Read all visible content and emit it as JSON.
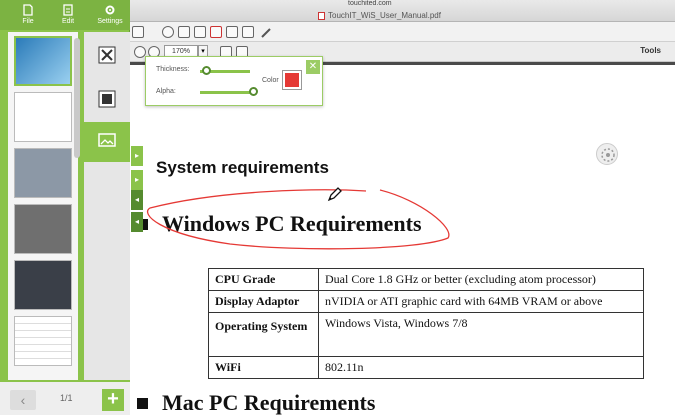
{
  "window": {
    "site": "touchited.com",
    "filename": "TouchIT_WiS_User_Manual.pdf"
  },
  "toolbar": {
    "zoom": "170%",
    "tools_label": "Tools"
  },
  "sidebar": {
    "file_label": "File",
    "edit_label": "Edit",
    "settings_label": "Settings",
    "page_indicator": "1/1",
    "accent_color": "#8bc34a"
  },
  "pen_settings": {
    "thickness_label": "Thickness:",
    "alpha_label": "Alpha:",
    "color_label": "Color",
    "thickness_level": 0.12,
    "alpha_level": 0.95,
    "ink_color": "#e53935"
  },
  "document": {
    "section_heading": "System requirements",
    "win_heading": "Windows PC Requirements",
    "mac_heading": "Mac PC Requirements",
    "table": [
      {
        "key": "CPU Grade",
        "value": "Dual Core 1.8 GHz or better (excluding atom processor)"
      },
      {
        "key": "Display Adaptor",
        "value": "nVIDIA or ATI graphic card with 64MB VRAM or above"
      },
      {
        "key": "Operating System",
        "value": "Windows Vista, Windows 7/8"
      },
      {
        "key": "WiFi",
        "value": "802.11n"
      }
    ]
  },
  "icons": [
    "file-icon",
    "edit-icon",
    "settings-icon",
    "tools-icon",
    "background-icon",
    "image-icon",
    "pencil-cursor-icon",
    "close-icon",
    "add-page-icon",
    "prev-page-icon",
    "focus-icon"
  ]
}
